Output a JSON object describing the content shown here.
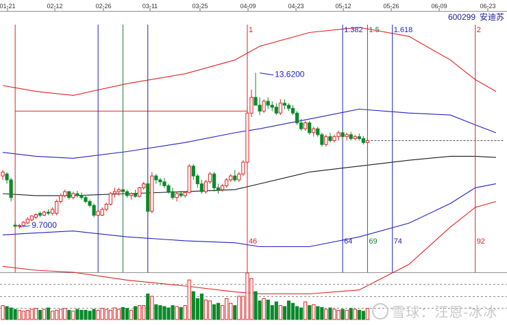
{
  "chart_data": {
    "type": "candlestick",
    "ticker": "600299",
    "name": "安迪苏",
    "x_ticks": [
      "01-21",
      "02-12",
      "02-26",
      "03-11",
      "03-25",
      "04-09",
      "04-23",
      "05-12",
      "05-26",
      "06-09",
      "06-23"
    ],
    "price_range": [
      8.6,
      14.85
    ],
    "annotations": [
      {
        "text": "13.6200",
        "bar": 62,
        "price": 13.62
      },
      {
        "text": "9.7000",
        "bar": 4,
        "price": 9.7
      }
    ],
    "vertical_lines": [
      {
        "bar": 3,
        "color": "#e02020",
        "top": "",
        "bottom": ""
      },
      {
        "bar": 23,
        "color": "#2020c0",
        "top": "",
        "bottom": ""
      },
      {
        "bar": 29,
        "color": "#1a7a3a",
        "top": "",
        "bottom": ""
      },
      {
        "bar": 35,
        "color": "#2020c0",
        "top": "",
        "bottom": ""
      },
      {
        "bar": 59,
        "color": "#e02020",
        "top": "1",
        "bottom": "46"
      },
      {
        "bar": 82,
        "color": "#2020c0",
        "top": "1.382",
        "bottom": "64"
      },
      {
        "bar": 88,
        "color": "#1a7a3a",
        "top": "1.5",
        "bottom": "69"
      },
      {
        "bar": 94,
        "color": "#2020c0",
        "top": "1.618",
        "bottom": "74"
      },
      {
        "bar": 114,
        "color": "#e02020",
        "top": "2",
        "bottom": "92"
      }
    ],
    "bands": {
      "black_mid": [
        [
          0,
          10.55
        ],
        [
          8,
          10.5
        ],
        [
          17,
          10.5
        ],
        [
          30,
          10.55
        ],
        [
          44,
          10.6
        ],
        [
          56,
          10.65
        ],
        [
          62,
          10.8
        ],
        [
          74,
          11.1
        ],
        [
          86,
          11.25
        ],
        [
          98,
          11.4
        ],
        [
          108,
          11.5
        ],
        [
          114,
          11.5
        ],
        [
          119,
          11.47
        ]
      ],
      "blue_upper": [
        [
          0,
          11.6
        ],
        [
          8,
          11.5
        ],
        [
          17,
          11.45
        ],
        [
          30,
          11.62
        ],
        [
          44,
          11.85
        ],
        [
          56,
          12.1
        ],
        [
          62,
          12.2
        ],
        [
          74,
          12.45
        ],
        [
          86,
          12.7
        ],
        [
          98,
          12.6
        ],
        [
          108,
          12.55
        ],
        [
          114,
          12.3
        ],
        [
          119,
          12.1
        ]
      ],
      "blue_lower": [
        [
          0,
          9.5
        ],
        [
          8,
          9.55
        ],
        [
          17,
          9.6
        ],
        [
          30,
          9.45
        ],
        [
          44,
          9.35
        ],
        [
          56,
          9.3
        ],
        [
          62,
          9.2
        ],
        [
          74,
          9.2
        ],
        [
          86,
          9.45
        ],
        [
          98,
          9.8
        ],
        [
          108,
          10.3
        ],
        [
          114,
          10.7
        ],
        [
          119,
          10.8
        ]
      ],
      "red_upper": [
        [
          0,
          13.3
        ],
        [
          8,
          13.15
        ],
        [
          17,
          13.05
        ],
        [
          30,
          13.35
        ],
        [
          44,
          13.6
        ],
        [
          56,
          13.95
        ],
        [
          62,
          14.3
        ],
        [
          74,
          14.65
        ],
        [
          86,
          14.78
        ],
        [
          98,
          14.55
        ],
        [
          108,
          13.95
        ],
        [
          114,
          13.45
        ],
        [
          119,
          13.15
        ]
      ],
      "red_lower": [
        [
          0,
          8.7
        ],
        [
          8,
          8.6
        ],
        [
          17,
          8.55
        ],
        [
          30,
          8.35
        ],
        [
          44,
          8.2
        ],
        [
          56,
          8.05
        ],
        [
          62,
          8.0
        ],
        [
          74,
          8.0
        ],
        [
          86,
          8.1
        ],
        [
          98,
          8.75
        ],
        [
          108,
          9.7
        ],
        [
          114,
          10.2
        ],
        [
          119,
          10.35
        ]
      ],
      "red_horizontal": {
        "price": 12.65,
        "from_bar": 3,
        "to_bar": 59
      }
    },
    "candles": [
      [
        11.0,
        11.15,
        10.9,
        11.1
      ],
      [
        11.05,
        11.1,
        10.8,
        10.9
      ],
      [
        10.9,
        10.95,
        10.35,
        10.45
      ],
      [
        9.75,
        9.85,
        9.68,
        9.72
      ],
      [
        9.72,
        9.78,
        9.66,
        9.74
      ],
      [
        9.74,
        9.85,
        9.72,
        9.82
      ],
      [
        9.8,
        9.95,
        9.78,
        9.9
      ],
      [
        9.88,
        10.0,
        9.85,
        9.98
      ],
      [
        9.95,
        10.05,
        9.9,
        10.02
      ],
      [
        10.05,
        10.1,
        9.95,
        10.0
      ],
      [
        10.0,
        10.12,
        9.98,
        10.08
      ],
      [
        10.08,
        10.15,
        10.0,
        10.05
      ],
      [
        10.05,
        10.2,
        10.0,
        10.15
      ],
      [
        10.05,
        10.4,
        10.0,
        10.35
      ],
      [
        10.35,
        10.55,
        10.3,
        10.5
      ],
      [
        10.5,
        10.65,
        10.45,
        10.6
      ],
      [
        10.6,
        10.62,
        10.4,
        10.45
      ],
      [
        10.45,
        10.6,
        10.4,
        10.55
      ],
      [
        10.55,
        10.62,
        10.45,
        10.5
      ],
      [
        10.5,
        10.58,
        10.4,
        10.45
      ],
      [
        10.45,
        10.5,
        10.3,
        10.35
      ],
      [
        10.35,
        10.4,
        10.2,
        10.25
      ],
      [
        10.25,
        10.3,
        9.95,
        10.0
      ],
      [
        10.0,
        10.15,
        9.95,
        10.1
      ],
      [
        10.0,
        10.2,
        9.98,
        10.15
      ],
      [
        10.15,
        10.32,
        10.1,
        10.28
      ],
      [
        10.28,
        10.6,
        10.25,
        10.55
      ],
      [
        10.55,
        10.7,
        10.45,
        10.6
      ],
      [
        10.6,
        10.7,
        10.5,
        10.65
      ],
      [
        10.65,
        10.72,
        10.55,
        10.6
      ],
      [
        10.6,
        10.65,
        10.45,
        10.5
      ],
      [
        10.5,
        10.58,
        10.4,
        10.55
      ],
      [
        10.55,
        10.65,
        10.45,
        10.48
      ],
      [
        10.48,
        10.72,
        10.45,
        10.7
      ],
      [
        10.7,
        10.85,
        10.65,
        10.8
      ],
      [
        10.8,
        11.0,
        10.0,
        10.1
      ],
      [
        10.1,
        11.1,
        10.05,
        11.0
      ],
      [
        11.0,
        11.05,
        10.8,
        10.9
      ],
      [
        10.9,
        10.95,
        10.75,
        10.85
      ],
      [
        10.85,
        10.95,
        10.7,
        10.75
      ],
      [
        10.75,
        10.8,
        10.55,
        10.6
      ],
      [
        10.6,
        10.7,
        10.4,
        10.45
      ],
      [
        10.45,
        10.6,
        10.35,
        10.55
      ],
      [
        10.55,
        10.62,
        10.45,
        10.5
      ],
      [
        10.5,
        10.6,
        10.45,
        10.58
      ],
      [
        10.58,
        11.3,
        10.55,
        11.25
      ],
      [
        11.25,
        11.3,
        10.9,
        11.0
      ],
      [
        11.0,
        11.05,
        10.7,
        10.8
      ],
      [
        10.8,
        10.9,
        10.55,
        10.6
      ],
      [
        10.6,
        10.9,
        10.55,
        10.85
      ],
      [
        10.85,
        11.1,
        10.8,
        11.05
      ],
      [
        11.05,
        11.1,
        10.6,
        10.7
      ],
      [
        10.7,
        10.8,
        10.55,
        10.65
      ],
      [
        10.65,
        10.8,
        10.6,
        10.75
      ],
      [
        10.75,
        10.95,
        10.7,
        10.9
      ],
      [
        10.9,
        11.05,
        10.85,
        11.0
      ],
      [
        11.0,
        11.15,
        10.85,
        10.9
      ],
      [
        10.9,
        11.1,
        10.85,
        11.05
      ],
      [
        11.05,
        11.4,
        11.0,
        11.35
      ],
      [
        11.35,
        12.75,
        11.3,
        12.6
      ],
      [
        12.6,
        13.2,
        12.5,
        13.0
      ],
      [
        13.0,
        13.62,
        12.9,
        12.8
      ],
      [
        12.8,
        13.0,
        12.55,
        12.65
      ],
      [
        12.65,
        12.95,
        12.6,
        12.9
      ],
      [
        12.9,
        13.0,
        12.7,
        12.8
      ],
      [
        12.8,
        12.9,
        12.65,
        12.75
      ],
      [
        12.75,
        12.85,
        12.55,
        12.6
      ],
      [
        12.6,
        12.95,
        12.55,
        12.85
      ],
      [
        12.85,
        12.95,
        12.7,
        12.8
      ],
      [
        12.8,
        12.85,
        12.65,
        12.72
      ],
      [
        12.72,
        12.8,
        12.55,
        12.6
      ],
      [
        12.6,
        12.65,
        12.3,
        12.35
      ],
      [
        12.35,
        12.45,
        12.15,
        12.2
      ],
      [
        12.2,
        12.4,
        12.15,
        12.35
      ],
      [
        12.35,
        12.4,
        12.05,
        12.1
      ],
      [
        12.1,
        12.25,
        12.0,
        12.2
      ],
      [
        12.2,
        12.25,
        12.0,
        12.05
      ],
      [
        12.05,
        12.1,
        11.75,
        11.8
      ],
      [
        11.8,
        12.05,
        11.75,
        12.0
      ],
      [
        12.0,
        12.1,
        11.85,
        11.9
      ],
      [
        11.9,
        12.05,
        11.85,
        12.0
      ],
      [
        12.0,
        12.15,
        11.9,
        12.1
      ],
      [
        12.1,
        12.18,
        11.95,
        12.0
      ],
      [
        12.0,
        12.1,
        11.9,
        12.05
      ],
      [
        12.05,
        12.12,
        11.9,
        11.95
      ],
      [
        11.95,
        12.05,
        11.9,
        12.0
      ],
      [
        12.0,
        12.08,
        11.9,
        11.95
      ],
      [
        11.95,
        12.02,
        11.8,
        11.85
      ],
      [
        11.85,
        11.95,
        11.82,
        11.9
      ]
    ],
    "volumes": [
      0.3,
      0.28,
      0.25,
      0.22,
      0.2,
      0.18,
      0.2,
      0.22,
      0.24,
      0.2,
      0.22,
      0.25,
      0.18,
      0.2,
      0.22,
      0.24,
      0.2,
      0.18,
      0.22,
      0.2,
      0.2,
      0.18,
      0.22,
      0.2,
      0.24,
      0.22,
      0.2,
      0.25,
      0.22,
      0.26,
      0.24,
      0.2,
      0.28,
      0.3,
      0.3,
      0.55,
      0.5,
      0.32,
      0.3,
      0.28,
      0.25,
      0.3,
      0.28,
      0.26,
      0.3,
      0.85,
      0.6,
      0.45,
      0.55,
      0.42,
      0.4,
      0.32,
      0.35,
      0.3,
      0.45,
      0.35,
      0.3,
      0.5,
      0.5,
      1.0,
      0.88,
      0.6,
      0.4,
      0.45,
      0.42,
      0.3,
      0.38,
      0.3,
      0.28,
      0.4,
      0.35,
      0.28,
      0.25,
      0.38,
      0.3,
      0.32,
      0.28,
      0.26,
      0.22,
      0.25,
      0.22,
      0.2,
      0.22,
      0.2,
      0.24,
      0.22,
      0.2,
      0.18,
      0.24
    ],
    "watermark": "雪球：汪恩-冰冰"
  }
}
